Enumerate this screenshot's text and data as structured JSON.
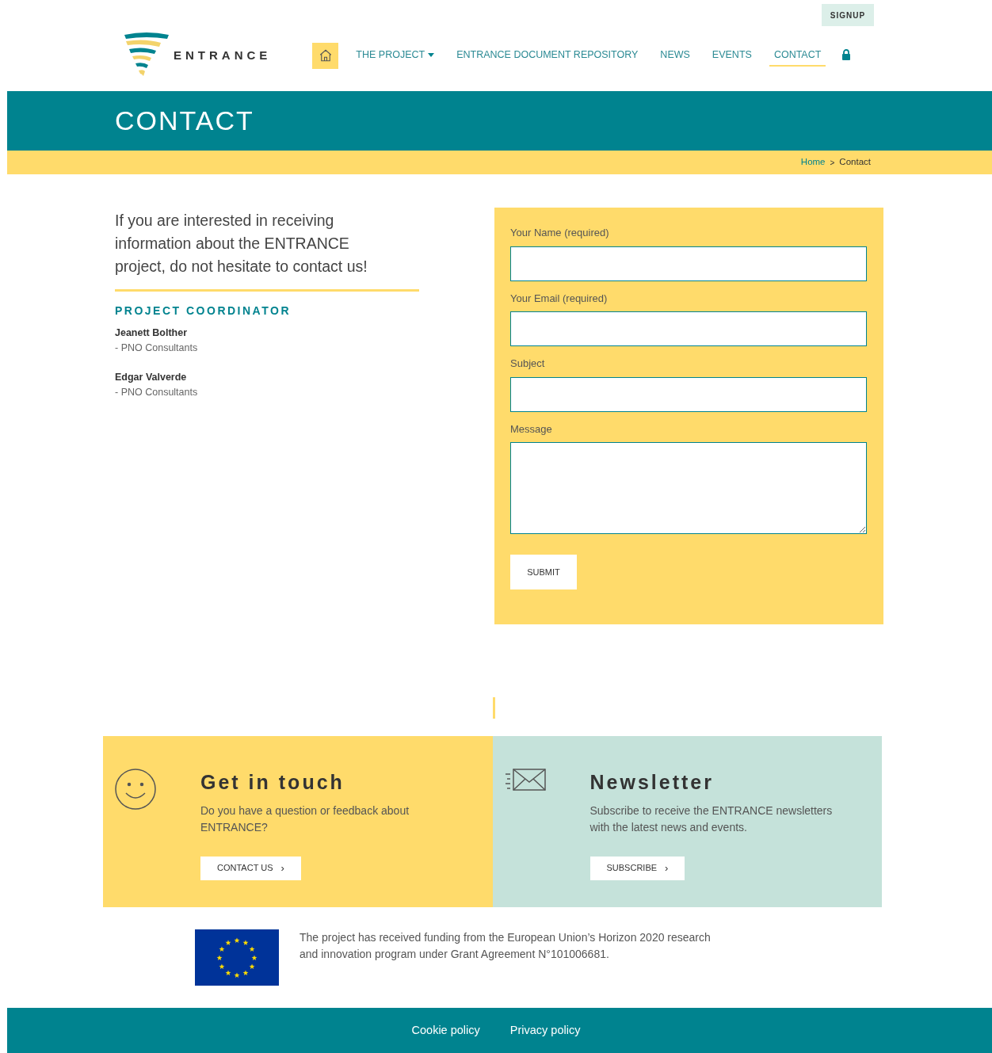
{
  "header": {
    "signup": "SIGNUP",
    "logo_text": "ENTRANCE",
    "nav": [
      {
        "kind": "home",
        "selected": false
      },
      {
        "kind": "dropdown",
        "label": "THE PROJECT",
        "selected": false
      },
      {
        "kind": "link",
        "label": "ENTRANCE DOCUMENT REPOSITORY",
        "selected": false
      },
      {
        "kind": "link",
        "label": "NEWS",
        "selected": false
      },
      {
        "kind": "link",
        "label": "EVENTS",
        "selected": false
      },
      {
        "kind": "link",
        "label": "CONTACT",
        "selected": true
      },
      {
        "kind": "lock",
        "selected": false
      }
    ]
  },
  "page_title": "CONTACT",
  "breadcrumb": {
    "home": "Home",
    "separator": ">",
    "current": "Contact"
  },
  "intro": "If you are interested in receiving information about the ENTRANCE project, do not hesitate to contact us!",
  "coordinator": {
    "heading": "PROJECT COORDINATOR",
    "people": [
      {
        "name": "Jeanett Bolther",
        "org": "- PNO Consultants"
      },
      {
        "name": "Edgar Valverde",
        "org": "- PNO Consultants"
      }
    ]
  },
  "form": {
    "fields": [
      {
        "label": "Your Name (required)",
        "kind": "input"
      },
      {
        "label": "Your Email (required)",
        "kind": "input"
      },
      {
        "label": "Subject",
        "kind": "input"
      },
      {
        "label": "Message",
        "kind": "textarea"
      }
    ],
    "submit": "SUBMIT"
  },
  "cards": [
    {
      "kind": "smiley",
      "title": "Get in touch",
      "text": "Do you have a question or feedback about ENTRANCE?",
      "button": "CONTACT US",
      "chevron": "›"
    },
    {
      "kind": "mail",
      "title": "Newsletter",
      "text": "Subscribe to receive the ENTRANCE newsletters with the latest news and events.",
      "button": "SUBSCRIBE",
      "chevron": "›"
    }
  ],
  "funding": "The project has received funding from the European Union’s Horizon 2020 research and innovation program under Grant Agreement N°101006681.",
  "footer": {
    "links": [
      "Cookie policy",
      "Privacy policy"
    ]
  }
}
